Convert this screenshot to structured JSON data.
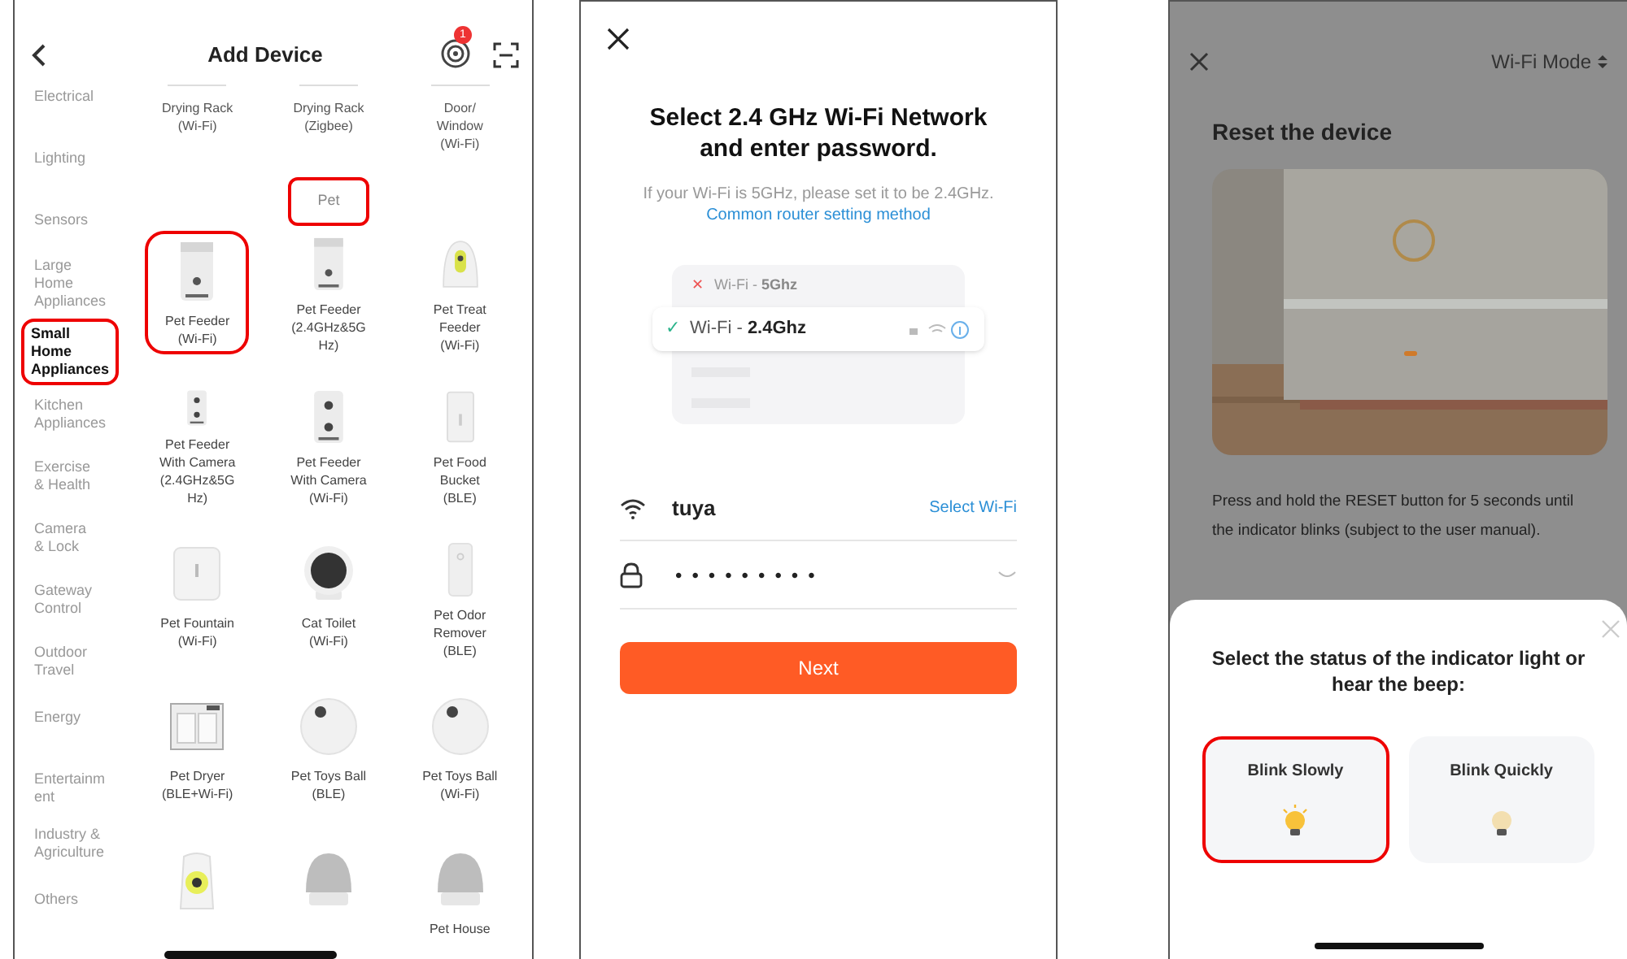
{
  "add_device": {
    "title": "Add Device",
    "badge": "1",
    "categories": [
      {
        "label": "Electrical",
        "selected": false
      },
      {
        "label": "Lighting",
        "selected": false
      },
      {
        "label": "Sensors",
        "selected": false
      },
      {
        "label": "Large\nHome\nAppliances",
        "selected": false
      },
      {
        "label": "Small\nHome\nAppliances",
        "selected": true
      },
      {
        "label": "Kitchen\nAppliances",
        "selected": false
      },
      {
        "label": "Exercise\n& Health",
        "selected": false
      },
      {
        "label": "Camera\n& Lock",
        "selected": false
      },
      {
        "label": "Gateway\nControl",
        "selected": false
      },
      {
        "label": "Outdoor\nTravel",
        "selected": false
      },
      {
        "label": "Energy",
        "selected": false
      },
      {
        "label": "Entertainm\nent",
        "selected": false
      },
      {
        "label": "Industry &\nAgriculture",
        "selected": false
      },
      {
        "label": "Others",
        "selected": false
      }
    ],
    "top_devices": [
      {
        "label": "Drying Rack\n(Wi-Fi)"
      },
      {
        "label": "Drying Rack\n(Zigbee)"
      },
      {
        "label": "Door/\nWindow\n(Wi-Fi)"
      }
    ],
    "section": {
      "title": "Pet",
      "highlighted": true
    },
    "device_rows": [
      [
        {
          "label": "Pet Feeder\n(Wi-Fi)",
          "kind": "feeder",
          "highlighted": true
        },
        {
          "label": "Pet Feeder\n(2.4GHz&5G\nHz)",
          "kind": "feeder",
          "highlighted": false
        },
        {
          "label": "Pet Treat\nFeeder\n(Wi-Fi)",
          "kind": "treat",
          "highlighted": false
        }
      ],
      [
        {
          "label": "Pet Feeder\nWith Camera\n(2.4GHz&5G\nHz)",
          "kind": "camera-feeder",
          "highlighted": false
        },
        {
          "label": "Pet Feeder\nWith Camera\n(Wi-Fi)",
          "kind": "camera-feeder",
          "highlighted": false
        },
        {
          "label": "Pet Food\nBucket\n(BLE)",
          "kind": "bucket",
          "highlighted": false
        }
      ],
      [
        {
          "label": "Pet Fountain\n(Wi-Fi)",
          "kind": "fountain",
          "highlighted": false
        },
        {
          "label": "Cat Toilet\n(Wi-Fi)",
          "kind": "cat-toilet",
          "highlighted": false
        },
        {
          "label": "Pet Odor\nRemover\n(BLE)",
          "kind": "odor",
          "highlighted": false
        }
      ],
      [
        {
          "label": "Pet Dryer\n(BLE+Wi-Fi)",
          "kind": "dryer",
          "highlighted": false
        },
        {
          "label": "Pet Toys Ball\n(BLE)",
          "kind": "ball",
          "highlighted": false
        },
        {
          "label": "Pet Toys Ball\n(Wi-Fi)",
          "kind": "ball",
          "highlighted": false
        }
      ],
      [
        {
          "kind": "lamp",
          "highlighted": false
        },
        {
          "kind": "dome",
          "highlighted": false
        },
        {
          "label": "Pet House",
          "kind": "dome",
          "highlighted": false
        }
      ]
    ]
  },
  "wifi_setup": {
    "title": "Select 2.4 GHz Wi-Fi Network and enter password.",
    "hint": "If your Wi-Fi is 5GHz, please set it to be 2.4GHz.",
    "hint_link": "Common router setting method",
    "networks": [
      {
        "mark": "✕",
        "prefix": "Wi-Fi - ",
        "band": "5Ghz",
        "selected": false
      },
      {
        "mark": "✓",
        "prefix": "Wi-Fi - ",
        "band": "2.4Ghz",
        "selected": true
      }
    ],
    "network_name": "tuya",
    "select_wifi": "Select Wi-Fi",
    "password": "•••••••••",
    "next": "Next"
  },
  "reset_device": {
    "mode": "Wi-Fi Mode",
    "title": "Reset the device",
    "instruction": "Press and hold the RESET button for 5 seconds until the indicator blinks (subject to the user manual).",
    "sheet": {
      "question": "Select the status of the indicator light or hear the beep:",
      "options": [
        {
          "label": "Blink Slowly",
          "selected": true
        },
        {
          "label": "Blink Quickly",
          "selected": false
        }
      ]
    }
  }
}
